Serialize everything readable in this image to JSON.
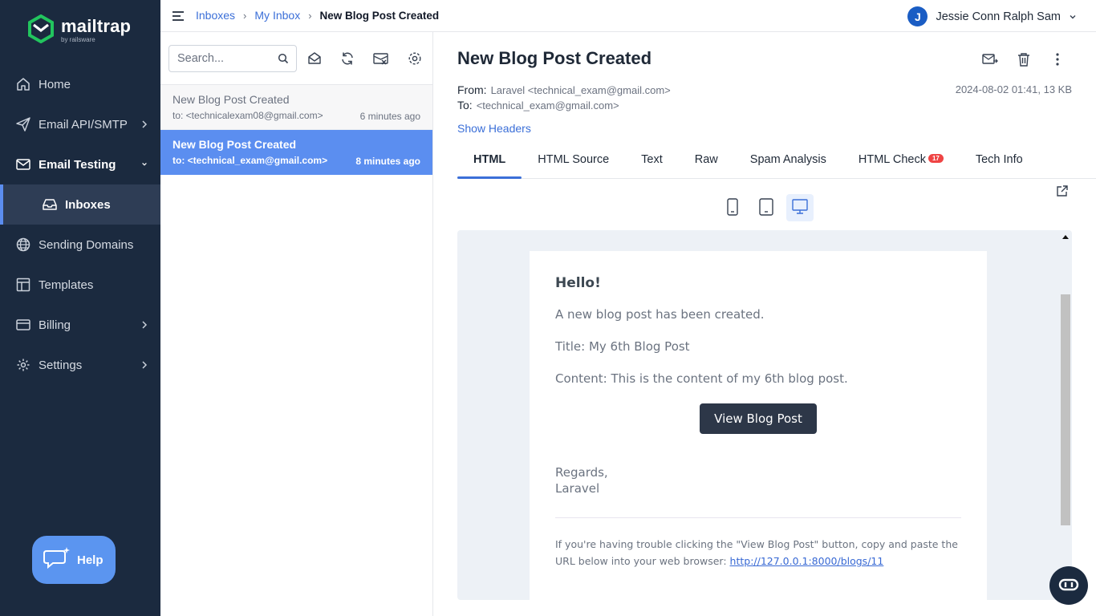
{
  "brand": {
    "name": "mailtrap",
    "sub": "by railsware"
  },
  "sidebar": {
    "items": [
      {
        "label": "Home"
      },
      {
        "label": "Email API/SMTP"
      },
      {
        "label": "Email Testing"
      },
      {
        "label": "Inboxes"
      },
      {
        "label": "Sending Domains"
      },
      {
        "label": "Templates"
      },
      {
        "label": "Billing"
      },
      {
        "label": "Settings"
      }
    ],
    "help_label": "Help"
  },
  "breadcrumb": {
    "item1": "Inboxes",
    "item2": "My Inbox",
    "current": "New Blog Post Created"
  },
  "user": {
    "initial": "J",
    "name": "Jessie Conn Ralph Sam"
  },
  "search": {
    "placeholder": "Search..."
  },
  "messages": [
    {
      "subject": "New Blog Post Created",
      "to": "to: <technicalexam08@gmail.com>",
      "time": "6 minutes ago",
      "selected": false
    },
    {
      "subject": "New Blog Post Created",
      "to": "to: <technical_exam@gmail.com>",
      "time": "8 minutes ago",
      "selected": true
    }
  ],
  "message": {
    "subject": "New Blog Post Created",
    "from_label": "From:",
    "from": "Laravel <technical_exam@gmail.com>",
    "to_label": "To:",
    "to": "<technical_exam@gmail.com>",
    "date_size": "2024-08-02 01:41, 13 KB",
    "show_headers": "Show Headers"
  },
  "tabs": [
    {
      "label": "HTML",
      "active": true
    },
    {
      "label": "HTML Source"
    },
    {
      "label": "Text"
    },
    {
      "label": "Raw"
    },
    {
      "label": "Spam Analysis"
    },
    {
      "label": "HTML Check",
      "badge": "17"
    },
    {
      "label": "Tech Info"
    }
  ],
  "email": {
    "greeting": "Hello!",
    "line1": "A new blog post has been created.",
    "line2": "Title: My 6th Blog Post",
    "line3": "Content: This is the content of my 6th blog post.",
    "button": "View Blog Post",
    "regards": "Regards,",
    "sender": "Laravel",
    "footer_text": "If you're having trouble clicking the \"View Blog Post\" button, copy and paste the URL below into your web browser:",
    "footer_link": "http://127.0.0.1:8000/blogs/11"
  },
  "colors": {
    "sidebar_bg": "#1b2a3f",
    "accent": "#3b6fd8",
    "selected_row": "#5b8ef0",
    "badge": "#ef4444"
  }
}
